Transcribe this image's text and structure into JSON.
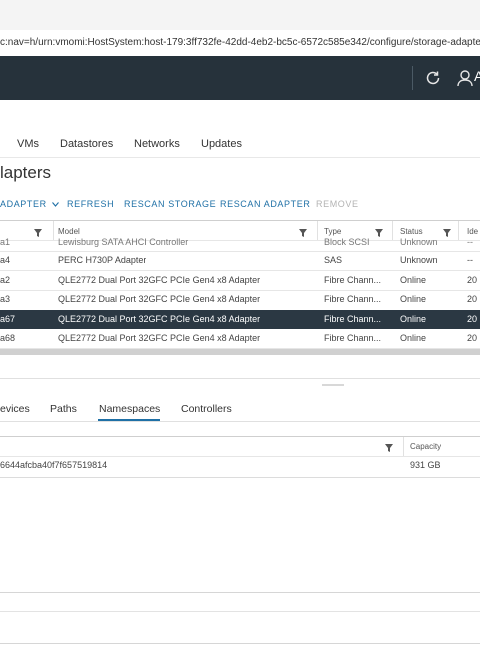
{
  "browser": {
    "address": "c:nav=h/urn:vmomi:HostSystem:host-179:3ff732fe-42dd-4eb2-bc5c-6572c585e342/configure/storage-adapters"
  },
  "header": {
    "user_initial": "A"
  },
  "tabs": [
    "VMs",
    "Datastores",
    "Networks",
    "Updates"
  ],
  "page_title": "lapters",
  "toolbar": {
    "add_label": "ADAPTER",
    "refresh_label": "REFRESH",
    "rescan_storage_label": "RESCAN STORAGE",
    "rescan_adapter_label": "RESCAN ADAPTER",
    "remove_label": "REMOVE"
  },
  "grid": {
    "columns": [
      "Model",
      "Type",
      "Status",
      "Ide"
    ],
    "rows": [
      {
        "adapter": "a1",
        "model": "Lewisburg SATA AHCI Controller",
        "type": "Block SCSI",
        "status": "Unknown",
        "ident": "--"
      },
      {
        "adapter": "a4",
        "model": "PERC H730P Adapter",
        "type": "SAS",
        "status": "Unknown",
        "ident": "--"
      },
      {
        "adapter": "a2",
        "model": "QLE2772 Dual Port 32GFC PCIe Gen4 x8 Adapter",
        "type": "Fibre Chann...",
        "status": "Online",
        "ident": "20"
      },
      {
        "adapter": "a3",
        "model": "QLE2772 Dual Port 32GFC PCIe Gen4 x8 Adapter",
        "type": "Fibre Chann...",
        "status": "Online",
        "ident": "20"
      },
      {
        "adapter": "a67",
        "model": "QLE2772 Dual Port 32GFC PCIe Gen4 x8 Adapter",
        "type": "Fibre Chann...",
        "status": "Online",
        "ident": "20"
      },
      {
        "adapter": "a68",
        "model": "QLE2772 Dual Port 32GFC PCIe Gen4 x8 Adapter",
        "type": "Fibre Chann...",
        "status": "Online",
        "ident": "20"
      }
    ]
  },
  "lower_tabs": [
    "evices",
    "Paths",
    "Namespaces",
    "Controllers"
  ],
  "namespaces": {
    "columns": [
      "Capacity"
    ],
    "rows": [
      {
        "name": "6644afcba40f7f657519814",
        "capacity": "931 GB"
      }
    ]
  }
}
